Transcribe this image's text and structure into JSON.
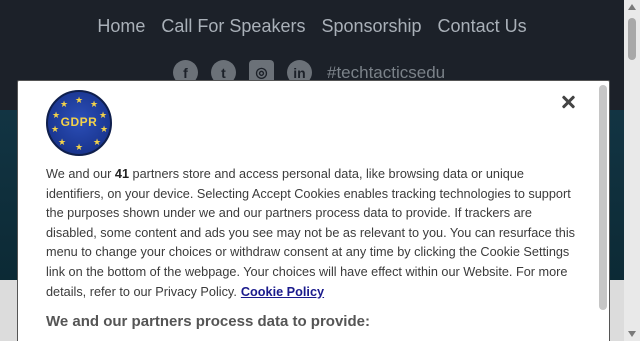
{
  "nav": {
    "items": [
      "Home",
      "Call For Speakers",
      "Sponsorship",
      "Contact Us"
    ]
  },
  "social": {
    "icons": [
      "facebook-icon",
      "twitter-icon",
      "instagram-icon",
      "linkedin-icon"
    ],
    "hashtag": "#techtacticsedu"
  },
  "consent": {
    "logo_text": "GDPR",
    "para_before_count": "We and our",
    "partner_count": "41",
    "para_after_count": "partners store and access personal data, like browsing data or unique identifiers, on your device. Selecting Accept Cookies enables tracking technologies to support the purposes shown under we and our partners process data to provide. If trackers are disabled, some content and ads you see may not be as relevant to you. You can resurface this menu to change your choices or withdraw consent at any time by clicking the Cookie Settings link on the bottom of the webpage. Your choices will have effect within our Website. For more details, refer to our Privacy Policy.",
    "cookie_policy_link": "Cookie Policy",
    "subheading": "We and our partners process data to provide:"
  },
  "colors": {
    "header_bg": "#1c2129",
    "hero_bg": "#123443",
    "link": "#1a1a8c",
    "gdpr_blue": "#1a3691",
    "gdpr_gold": "#f3d24a"
  }
}
